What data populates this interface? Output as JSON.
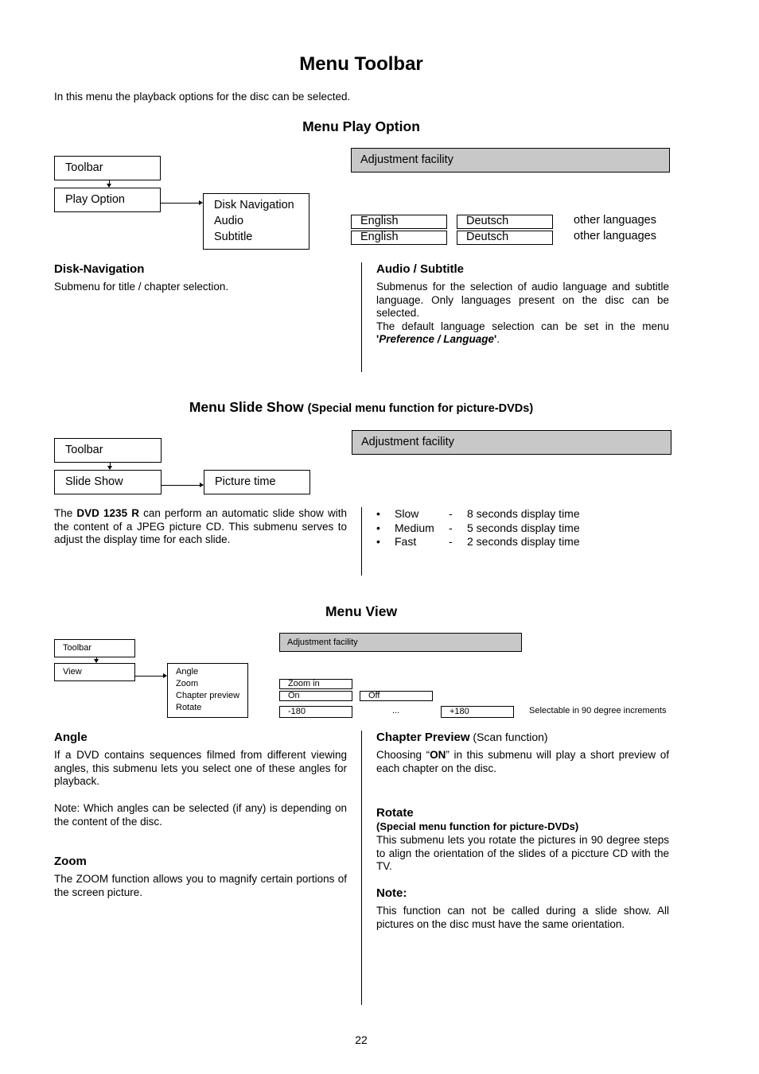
{
  "page": {
    "title": "Menu Toolbar",
    "intro": "In this menu the playback options for the disc can be selected.",
    "page_number": "22"
  },
  "play_option": {
    "heading": "Menu Play Option",
    "diagram": {
      "toolbar_label": "Toolbar",
      "submenu_label": "Play Option",
      "items": [
        "Disk Navigation",
        "Audio",
        "Subtitle"
      ]
    },
    "adjustment": {
      "label": "Adjustment facility",
      "rows": [
        {
          "option1": "English",
          "option2": "Deutsch",
          "more": "other languages"
        },
        {
          "option1": "English",
          "option2": "Deutsch",
          "more": "other languages"
        }
      ]
    },
    "left": {
      "heading": "Disk-Navigation",
      "text": "Submenu for title / chapter selection."
    },
    "right": {
      "heading": "Audio / Subtitle",
      "text1": "Submenus for the selection of audio language and subtitle language. Only languages present on the disc can be selected.",
      "text2": "The default language selection can be set in the menu ",
      "quote_open": "'",
      "menu_ref": "Preference / Language",
      "quote_close": "'",
      "period": "."
    }
  },
  "slide_show": {
    "heading": "Menu Slide Show",
    "heading_note": "(Special menu function for picture-DVDs)",
    "diagram": {
      "toolbar_label": "Toolbar",
      "submenu_label": "Slide Show",
      "item": "Picture time"
    },
    "adjustment": {
      "label": "Adjustment facility"
    },
    "left": {
      "text_before": "The ",
      "model": "DVD 1235 R",
      "text_after": " can perform an automatic slide show with the content of a JPEG picture CD. This submenu serves to adjust the display time for each slide."
    },
    "options": [
      {
        "bullet": "•",
        "name": "Slow",
        "dash": "-",
        "desc": "8 seconds display time"
      },
      {
        "bullet": "•",
        "name": "Medium",
        "dash": "-",
        "desc": "5 seconds display time"
      },
      {
        "bullet": "•",
        "name": "Fast",
        "dash": "-",
        "desc": "2 seconds display time"
      }
    ]
  },
  "view": {
    "heading": "Menu View",
    "diagram": {
      "toolbar_label": "Toolbar",
      "submenu_label": "View",
      "items": [
        "Angle",
        "Zoom",
        "Chapter preview",
        "Rotate"
      ]
    },
    "adjustment": {
      "label": "Adjustment facility",
      "zoom_option": "Zoom in",
      "preview_on": "On",
      "preview_off": "Off",
      "rotate_min": "-180",
      "rotate_ellipsis": "...",
      "rotate_max": "+180",
      "rotate_note": "Selectable in 90 degree increments"
    },
    "angle": {
      "heading": "Angle",
      "text": "If a DVD contains sequences filmed from different viewing angles, this submenu lets you select one of these angles for playback.",
      "note": "Note: Which angles can be selected (if any) is depending on the content of the disc."
    },
    "zoom": {
      "heading": "Zoom",
      "text": "The ZOOM function allows you to magnify certain portions of the screen picture."
    },
    "chapter_preview": {
      "heading": "Chapter Preview",
      "heading_note": " (Scan function)",
      "text_before": "Choosing “",
      "on": "ON",
      "text_after": "” in this submenu will play a short preview of each chapter on the disc."
    },
    "rotate": {
      "heading": "Rotate",
      "subheading": "(Special menu function for picture-DVDs)",
      "text": "This submenu lets you rotate the pictures in 90 degree steps to align the orientation of the slides of a piccture CD with the TV."
    },
    "note": {
      "heading": "Note:",
      "text": "This function can not be called during a slide show. All pictures on the disc must have the same orientation."
    }
  }
}
